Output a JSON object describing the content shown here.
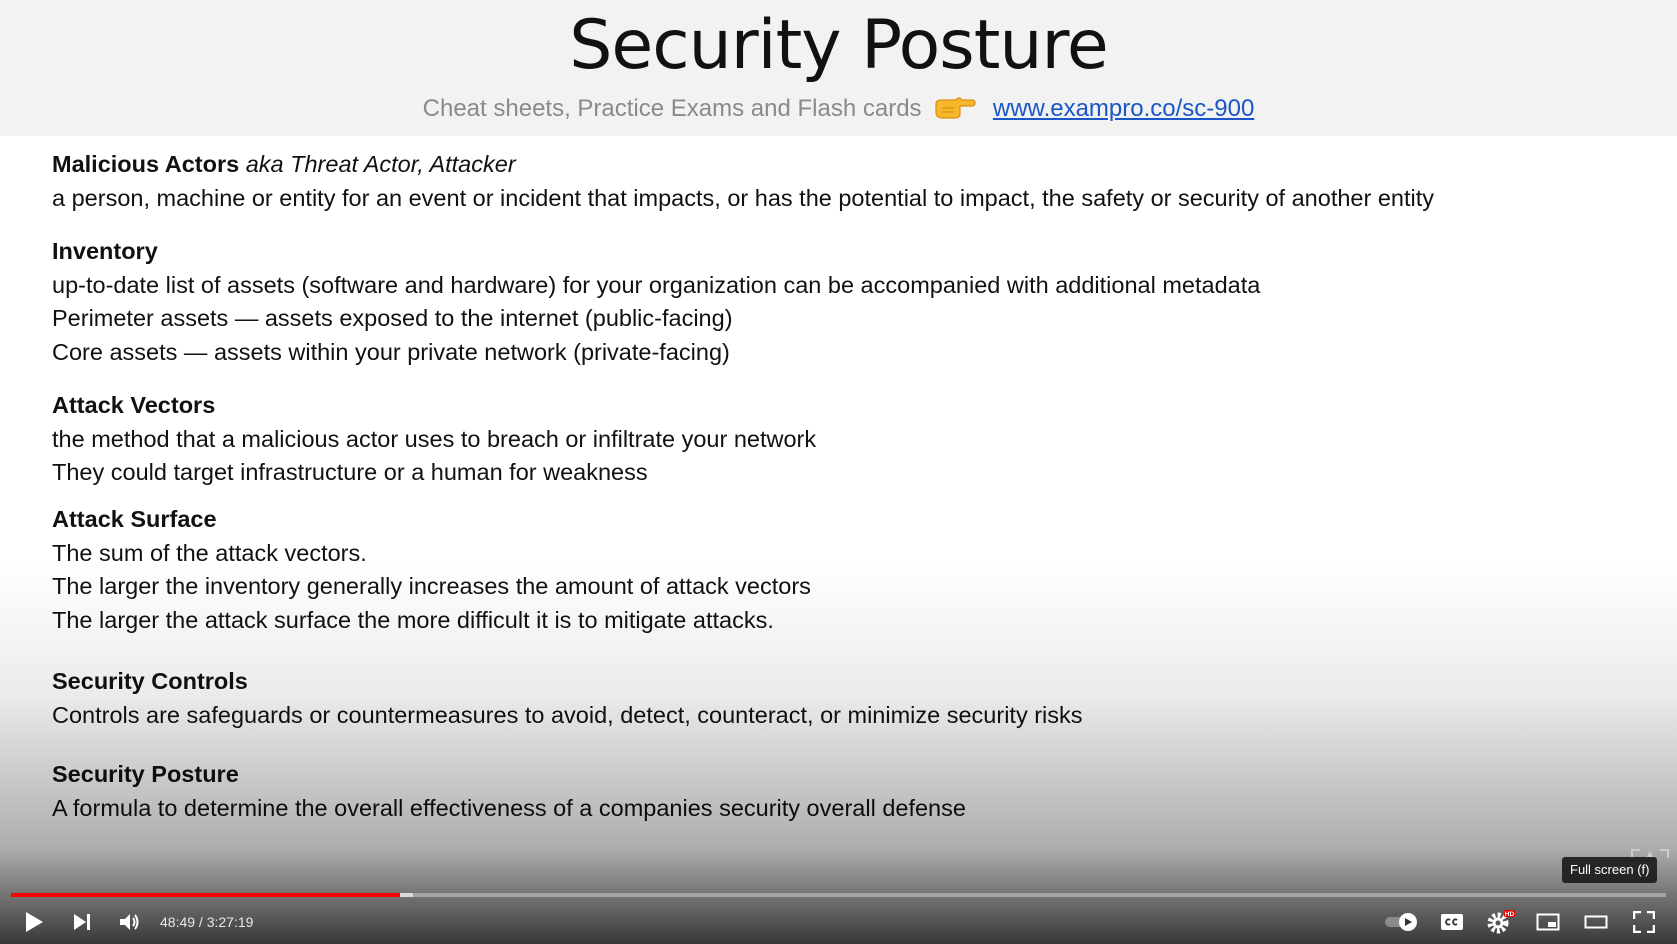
{
  "slide": {
    "title": "Security Posture",
    "subtitle_text": "Cheat sheets, Practice Exams and Flash cards",
    "subtitle_icon": "pointing-hand-icon",
    "link": "www.exampro.co/sc-900"
  },
  "sections": [
    {
      "heading": "Malicious Actors",
      "aka": "aka Threat Actor, Attacker",
      "lines": [
        "a person, machine or entity for an event or incident that impacts, or has the potential to impact, the safety or security of another entity"
      ]
    },
    {
      "heading": "Inventory",
      "aka": "",
      "lines": [
        "up-to-date list of assets (software and hardware) for your organization can be accompanied with additional metadata",
        "Perimeter assets — assets exposed to the internet (public-facing)",
        "Core assets — assets within your private network (private-facing)"
      ]
    },
    {
      "heading": "Attack Vectors",
      "aka": "",
      "lines": [
        "the method that a malicious actor uses to breach or infiltrate your network",
        "They could target infrastructure or a human for weakness"
      ]
    },
    {
      "heading": "Attack Surface",
      "aka": "",
      "lines": [
        "The sum of the attack vectors.",
        "The larger the inventory generally increases the amount of attack vectors",
        "The larger the attack surface the more difficult it is to mitigate attacks."
      ]
    },
    {
      "heading": "Security Controls",
      "aka": "",
      "lines": [
        "Controls are safeguards or countermeasures to avoid, detect, counteract, or minimize security risks"
      ]
    },
    {
      "heading": "Security Posture",
      "aka": "",
      "lines": [
        "A formula to determine the overall effectiveness of a companies security overall defense"
      ]
    }
  ],
  "player": {
    "time_display": "48:49 / 3:27:19",
    "progress_fraction": 0.2353,
    "buffered_fraction": 0.2432,
    "tooltip": "Full screen (f)",
    "badge_hd": "HD",
    "accent_color": "#ff0000",
    "icons": [
      "play-icon",
      "next-icon",
      "volume-icon",
      "autoplay-toggle-icon",
      "captions-icon",
      "settings-icon",
      "miniplayer-icon",
      "theater-mode-icon",
      "fullscreen-icon"
    ]
  }
}
